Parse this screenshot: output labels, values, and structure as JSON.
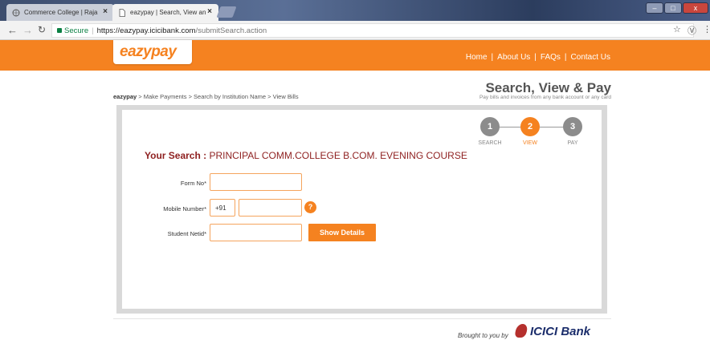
{
  "browser": {
    "tabs": [
      {
        "title": "Commerce College | Raja"
      },
      {
        "title": "eazypay | Search, View an"
      }
    ],
    "address": {
      "secure_label": "Secure",
      "host": "https://eazypay.icicibank.com",
      "path": "/submitSearch.action"
    },
    "window_controls": {
      "minimize": "–",
      "maximize": "□",
      "close": "x"
    }
  },
  "header": {
    "logo_text": "eazypay",
    "nav": [
      "Home",
      "About Us",
      "FAQs",
      "Contact Us"
    ],
    "separator": "|"
  },
  "breadcrumb": {
    "root": "eazypay",
    "trail": " > Make Payments > Search by Institution Name > View Bills"
  },
  "hero": {
    "title": "Search, View & Pay",
    "subtitle": "Pay bills and invoices from any bank account or any card"
  },
  "steps": [
    {
      "number": "1",
      "label": "SEARCH",
      "state": "done"
    },
    {
      "number": "2",
      "label": "VIEW",
      "state": "active"
    },
    {
      "number": "3",
      "label": "PAY",
      "state": "pending"
    }
  ],
  "search": {
    "prefix": "Your Search : ",
    "value": "PRINCIPAL COMM.COLLEGE B.COM. EVENING COURSE"
  },
  "form": {
    "form_no_label": "Form No*",
    "mobile_label": "Mobile Number*",
    "country_code": "+91",
    "student_label": "Student Netid*",
    "help_icon": "?",
    "submit_label": "Show Details"
  },
  "footer": {
    "brought_by": "Brought to you by",
    "brand": "ICICI",
    "brand_suffix": "Bank"
  },
  "colors": {
    "accent": "#f58220",
    "search_text": "#8e1f1f",
    "brand_blue": "#1b2d6b"
  }
}
